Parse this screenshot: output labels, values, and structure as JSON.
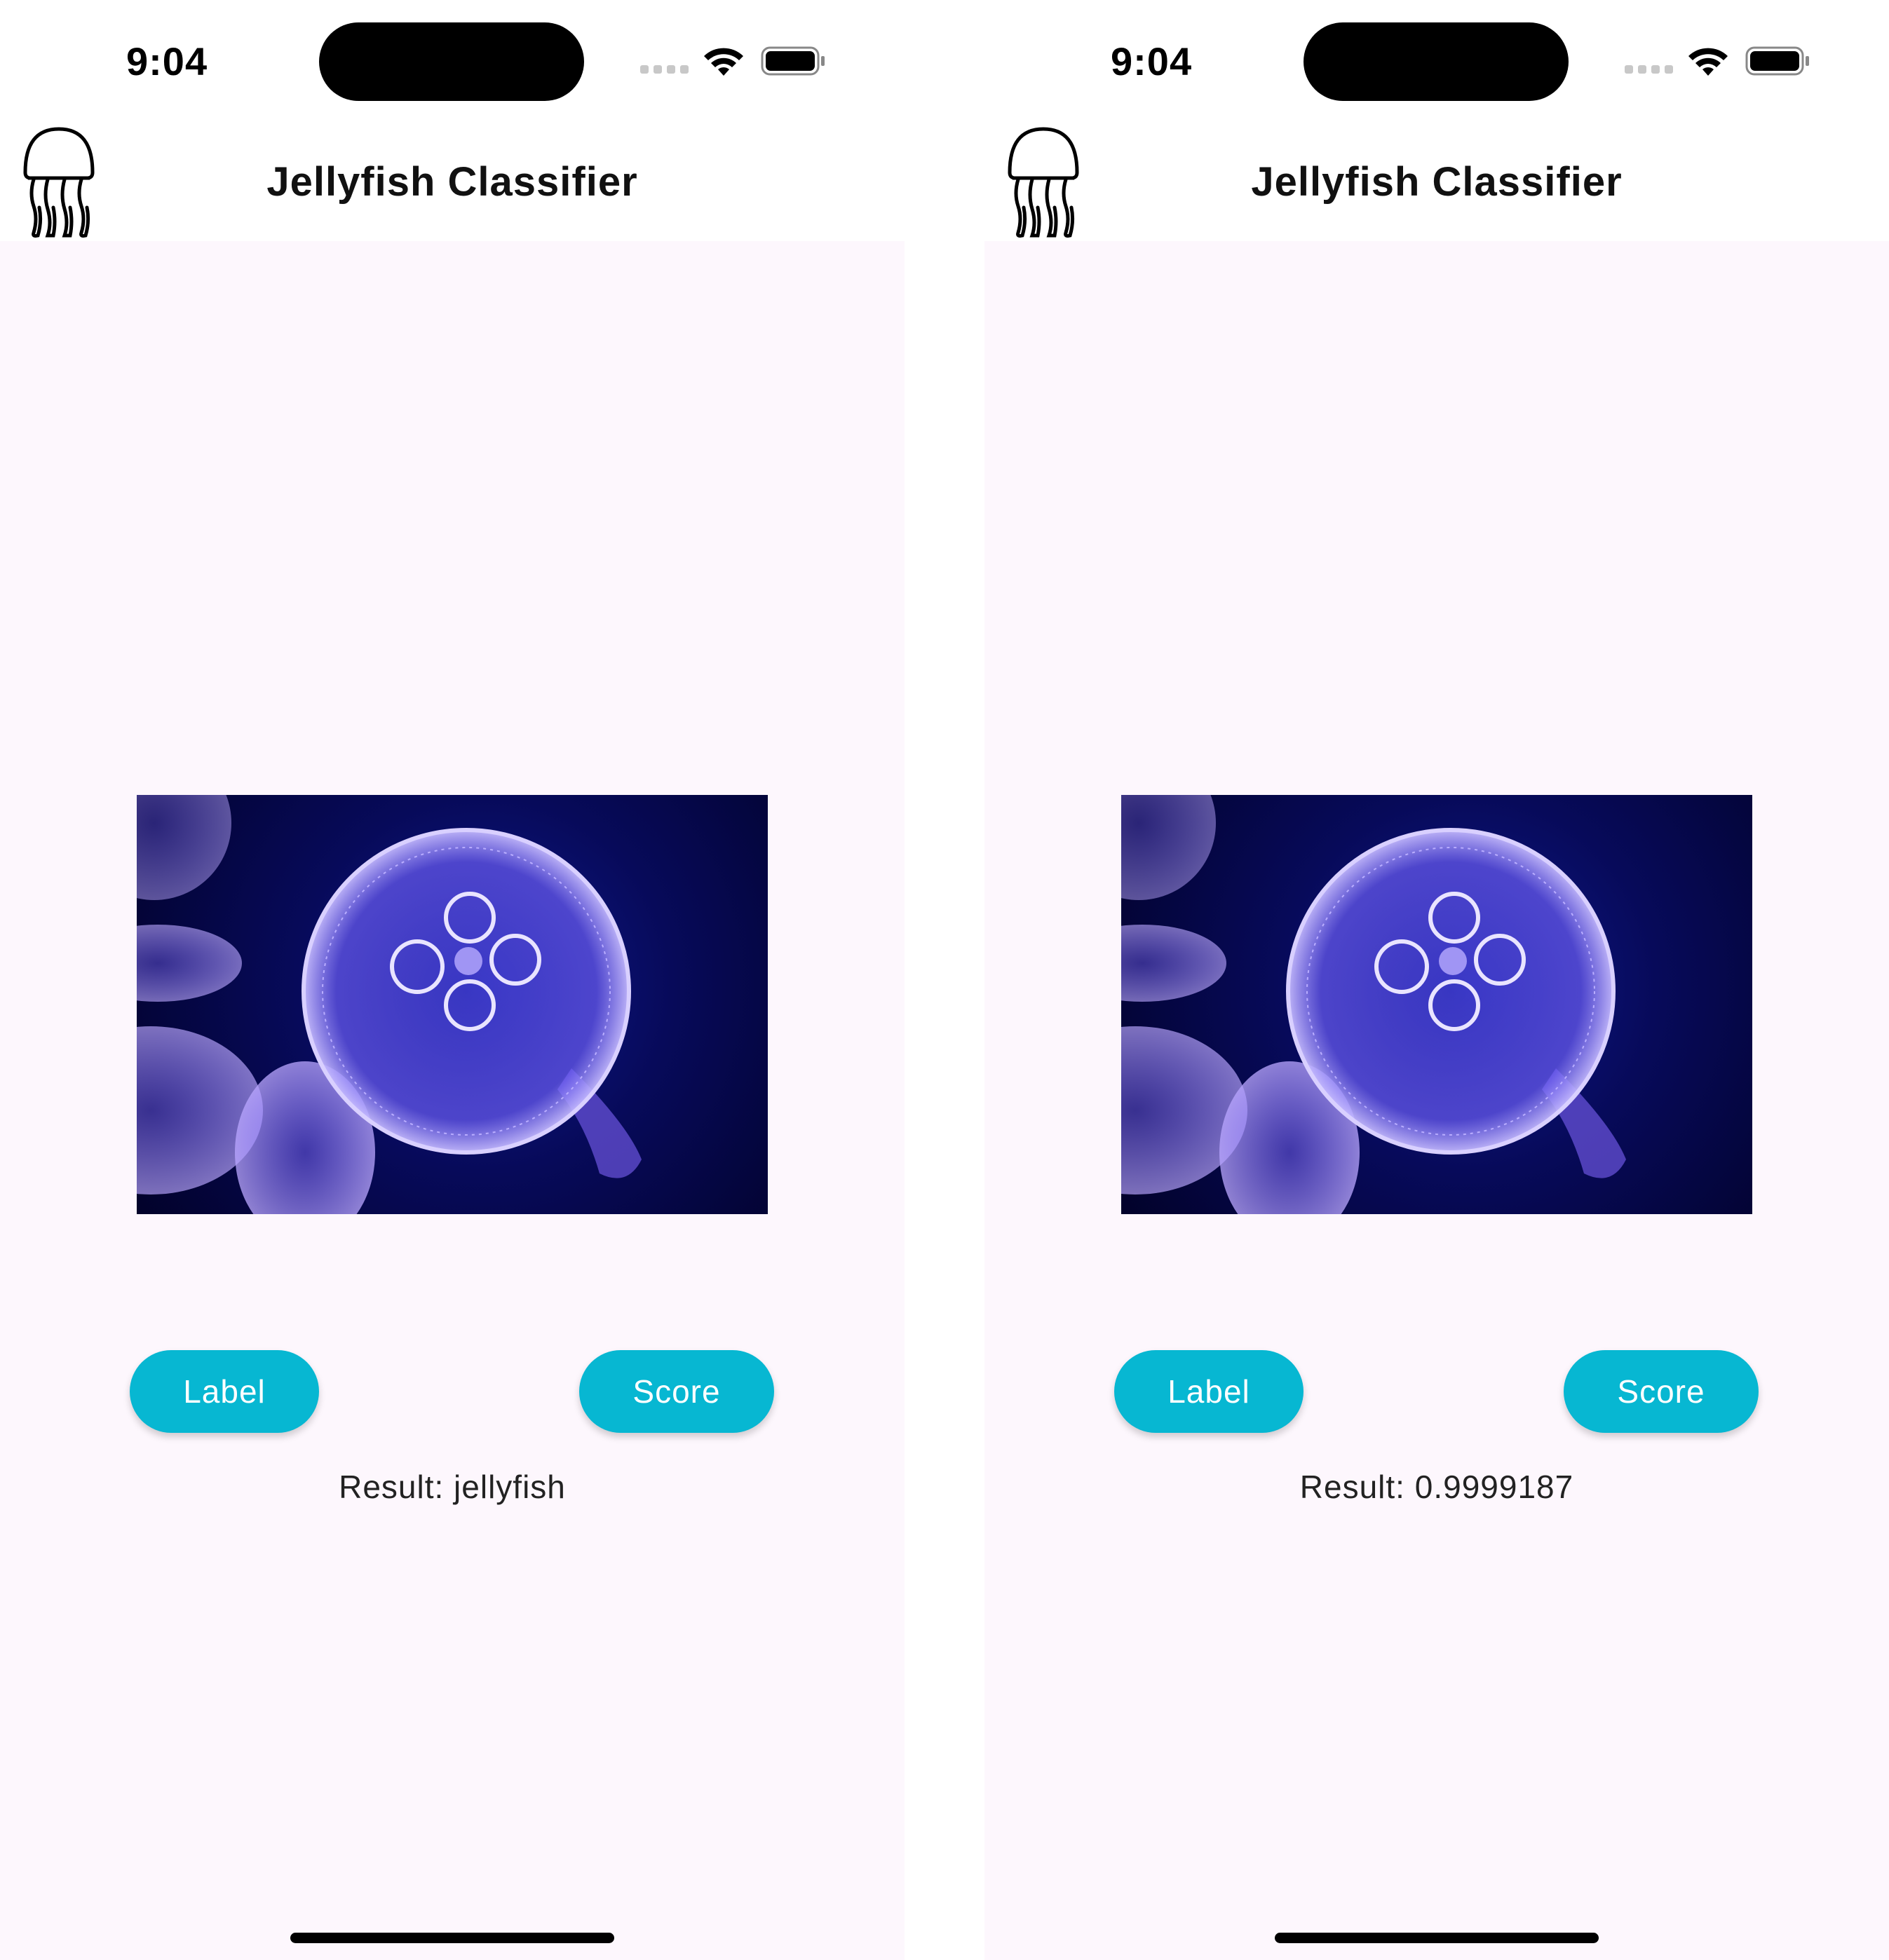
{
  "screens": [
    {
      "status_time": "9:04",
      "app_title": "Jellyfish Classifier",
      "buttons": {
        "label": "Label",
        "score": "Score"
      },
      "result_text": "Result: jellyfish"
    },
    {
      "status_time": "9:04",
      "app_title": "Jellyfish Classifier",
      "buttons": {
        "label": "Label",
        "score": "Score"
      },
      "result_text": "Result: 0.9999187"
    }
  ],
  "icons": {
    "app_logo": "jellyfish-icon",
    "status": [
      "cellular-signal-icon",
      "wifi-icon",
      "battery-icon"
    ]
  },
  "colors": {
    "accent": "#07b7d2",
    "background": "#fdf7fd",
    "app_bar": "#ffffff"
  }
}
